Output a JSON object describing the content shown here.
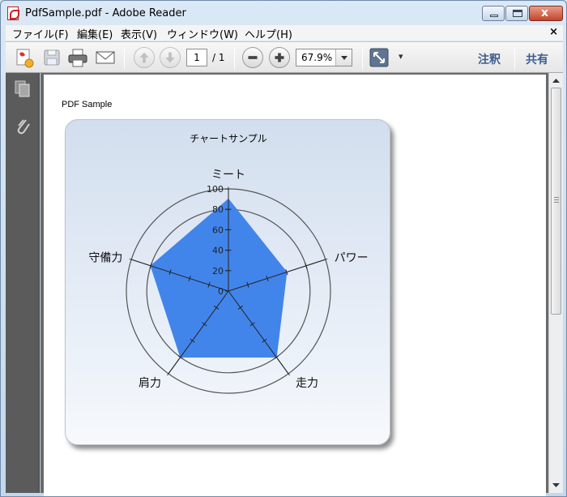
{
  "window": {
    "title": "PdfSample.pdf - Adobe Reader"
  },
  "menu": {
    "items": [
      "ファイル(F)",
      "編集(E)",
      "表示(V)",
      "ウィンドウ(W)",
      "ヘルプ(H)"
    ],
    "close": "×"
  },
  "toolbar": {
    "page_current": "1",
    "page_total": "/ 1",
    "zoom": "67.9%",
    "comment_label": "注釈",
    "share_label": "共有",
    "overflow": "▾"
  },
  "document": {
    "title": "PDF Sample"
  },
  "chart_data": {
    "type": "radar",
    "title": "チャートサンプル",
    "categories": [
      "ミート",
      "パワー",
      "走力",
      "肩力",
      "守備力"
    ],
    "values": [
      90,
      60,
      80,
      80,
      80
    ],
    "rlim": [
      0,
      100
    ],
    "ticks": [
      "0",
      "20",
      "40",
      "60",
      "80",
      "100"
    ],
    "series_color": "#4285ea"
  }
}
